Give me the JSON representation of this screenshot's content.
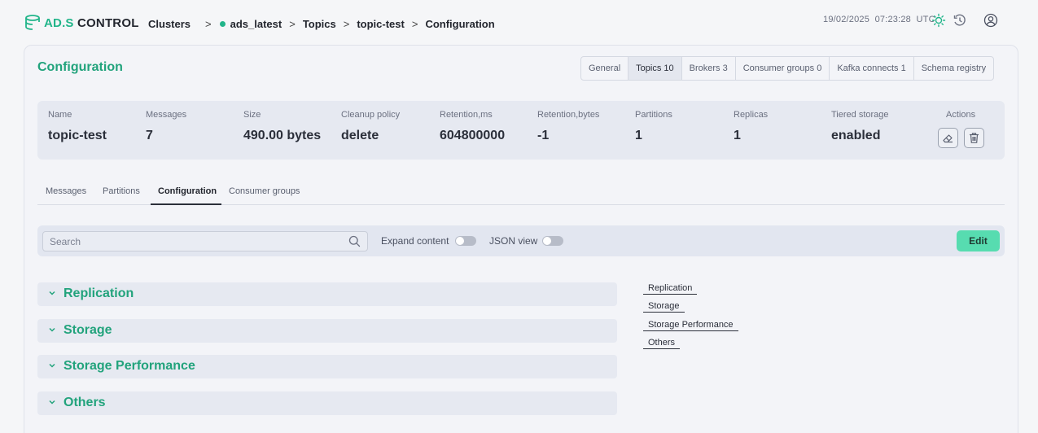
{
  "app": {
    "logo_text_accent": "AD.S",
    "logo_text_rest": "CONTROL",
    "colors": {
      "accent": "#22a37c",
      "edit_button": "#57dcb0"
    }
  },
  "breadcrumb": {
    "root": "Clusters",
    "cluster": "ads_latest",
    "topics": "Topics",
    "topic": "topic-test",
    "page": "Configuration"
  },
  "header": {
    "datetime": "19/02/2025  07:23:28",
    "timezone": "UTC",
    "icons": [
      "sun-icon",
      "history-icon",
      "user-icon"
    ]
  },
  "page_title": "Configuration",
  "top_nav": [
    {
      "label": "General",
      "active": false
    },
    {
      "label": "Topics 10",
      "active": true
    },
    {
      "label": "Brokers 3",
      "active": false
    },
    {
      "label": "Consumer groups 0",
      "active": false
    },
    {
      "label": "Kafka connects 1",
      "active": false
    },
    {
      "label": "Schema registry",
      "active": false
    }
  ],
  "summary": {
    "name": {
      "label": "Name",
      "value": "topic-test"
    },
    "messages": {
      "label": "Messages",
      "value": "7"
    },
    "size": {
      "label": "Size",
      "value": "490.00 bytes"
    },
    "cleanup": {
      "label": "Cleanup policy",
      "value": "delete"
    },
    "retention_ms": {
      "label": "Retention,ms",
      "value": "604800000"
    },
    "retention_bytes": {
      "label": "Retention,bytes",
      "value": "-1"
    },
    "partitions": {
      "label": "Partitions",
      "value": "1"
    },
    "replicas": {
      "label": "Replicas",
      "value": "1"
    },
    "tiered": {
      "label": "Tiered storage",
      "value": "enabled"
    },
    "actions_label": "Actions"
  },
  "tabs": [
    {
      "label": "Messages",
      "active": false
    },
    {
      "label": "Partitions",
      "active": false
    },
    {
      "label": "Configuration",
      "active": true
    },
    {
      "label": "Consumer groups",
      "active": false
    }
  ],
  "toolbar": {
    "search_placeholder": "Search",
    "expand_label": "Expand content",
    "expand_on": false,
    "json_label": "JSON view",
    "json_on": false,
    "edit_label": "Edit"
  },
  "sections": [
    "Replication",
    "Storage",
    "Storage Performance",
    "Others"
  ],
  "anchors": [
    "Replication",
    "Storage",
    "Storage Performance",
    "Others"
  ]
}
